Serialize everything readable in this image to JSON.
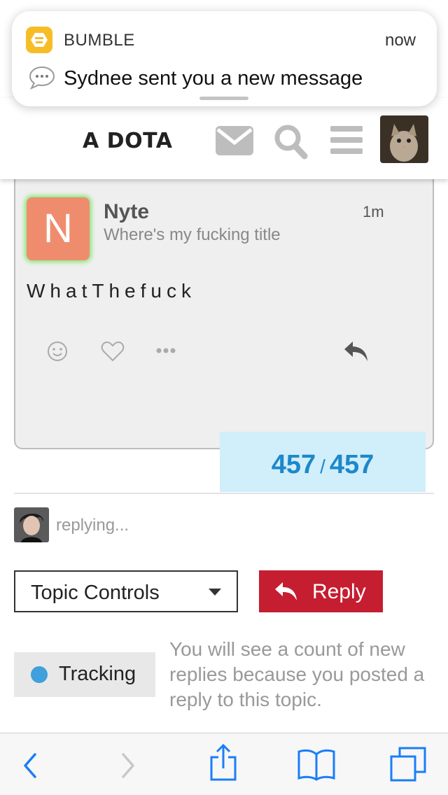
{
  "notification": {
    "app_name": "BUMBLE",
    "time": "now",
    "message": "Sydnee sent you a new message"
  },
  "header": {
    "logo_text": "A DOTA",
    "icons": [
      "envelope-icon",
      "search-icon",
      "hamburger-menu-icon",
      "user-avatar"
    ]
  },
  "post": {
    "avatar_letter": "N",
    "author": "Nyte",
    "subtitle": "Where's my fucking title",
    "time": "1m",
    "body": "WhatThefuck",
    "actions": [
      "smiley-icon",
      "heart-icon",
      "more-icon",
      "reply-arrow-icon"
    ]
  },
  "progress": {
    "current": "457",
    "separator": "/",
    "total": "457"
  },
  "replying": {
    "text": "replying..."
  },
  "controls": {
    "topic_controls_label": "Topic Controls",
    "reply_label": "Reply"
  },
  "tracking": {
    "label": "Tracking",
    "description": "You will see a count of new replies because you posted a reply to this topic."
  },
  "toolbar": {
    "items": [
      "back-icon",
      "forward-icon",
      "share-icon",
      "bookmarks-icon",
      "tabs-icon"
    ]
  },
  "colors": {
    "accent_blue": "#1d88c9",
    "reply_red": "#c51e30",
    "avatar_orange": "#ef8c6e",
    "bumble_yellow": "#f6bd27",
    "tracking_blue": "#3fa0dc"
  }
}
